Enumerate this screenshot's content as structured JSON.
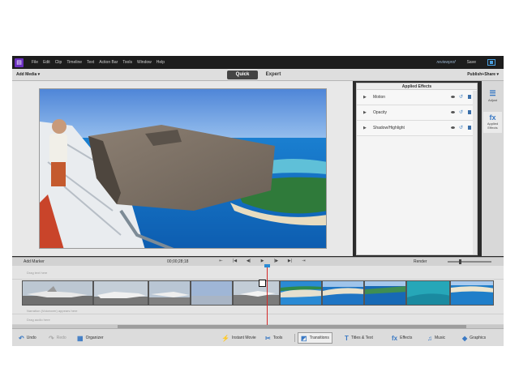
{
  "app": {
    "menu": [
      "File",
      "Edit",
      "Clip",
      "Timeline",
      "Text",
      "Action Bar",
      "Tools",
      "Window",
      "Help"
    ],
    "user": "reviewprof",
    "save": "Save"
  },
  "modebar": {
    "add_media": "Add Media ▾",
    "tabs": [
      "Quick",
      "Expert"
    ],
    "publish": "Publish+Share ▾"
  },
  "effects": {
    "title": "Applied Effects",
    "items": [
      "Motion",
      "Opacity",
      "Shadow/Highlight"
    ]
  },
  "tool_strip": {
    "adjust": "Adjust",
    "fx": "Applied Effects"
  },
  "timeline": {
    "add_marker": "Add Marker",
    "timecode": "00;00;28;18",
    "transport": [
      "⇤",
      "|◀",
      "◀|",
      "▶",
      "|▶",
      "▶|",
      "⇥"
    ],
    "render": "Render",
    "hints": {
      "title": "Drag text here",
      "narration": "Narration (Voiceover) appears here",
      "audio": "Drag audio here"
    }
  },
  "actionbar": {
    "undo": "Undo",
    "redo": "Redo",
    "organizer": "Organizer",
    "instant_movie": "Instant Movie",
    "tools": "Tools",
    "transitions": "Transitions",
    "titles": "Titles & Text",
    "effects": "Effects",
    "music": "Music",
    "graphics": "Graphics"
  }
}
